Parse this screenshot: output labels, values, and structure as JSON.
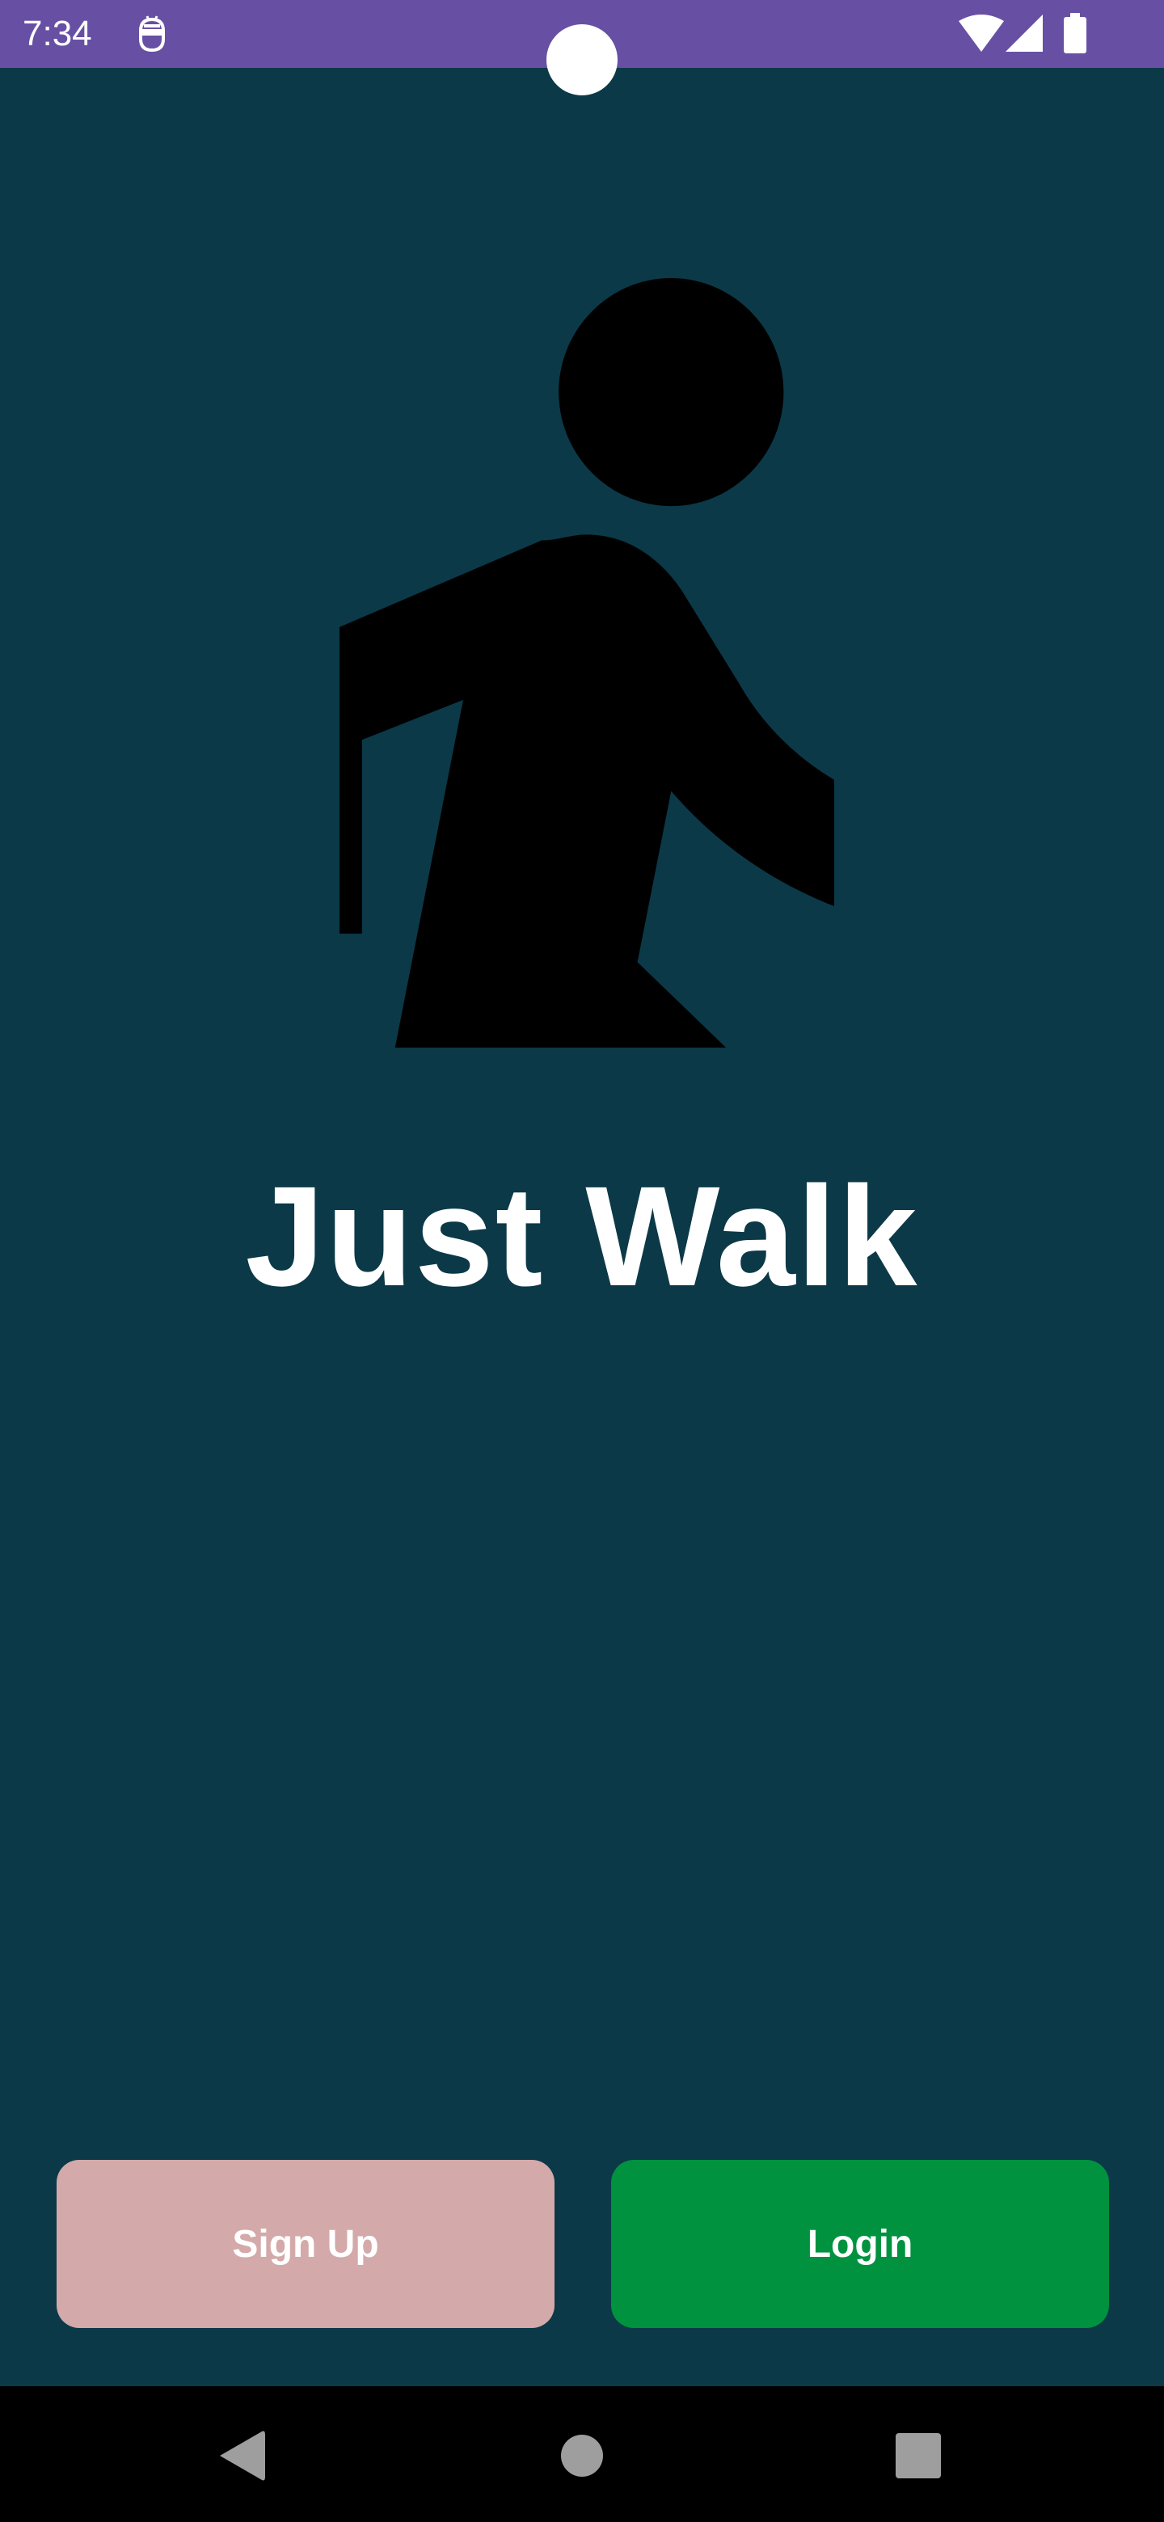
{
  "status_bar": {
    "time": "7:34",
    "background_color": "#6750a4",
    "icons": [
      "app-notification-icon",
      "wifi-icon",
      "signal-icon",
      "battery-icon"
    ]
  },
  "screen": {
    "background_color": "#0b3948",
    "logo_icon": "walking-person-icon",
    "title": "Just Walk"
  },
  "actions": {
    "signup_label": "Sign Up",
    "signup_color": "#d4a9a9",
    "login_label": "Login",
    "login_color": "#00923f"
  },
  "nav_bar": {
    "icons": [
      "back-icon",
      "home-icon",
      "recents-icon"
    ]
  }
}
